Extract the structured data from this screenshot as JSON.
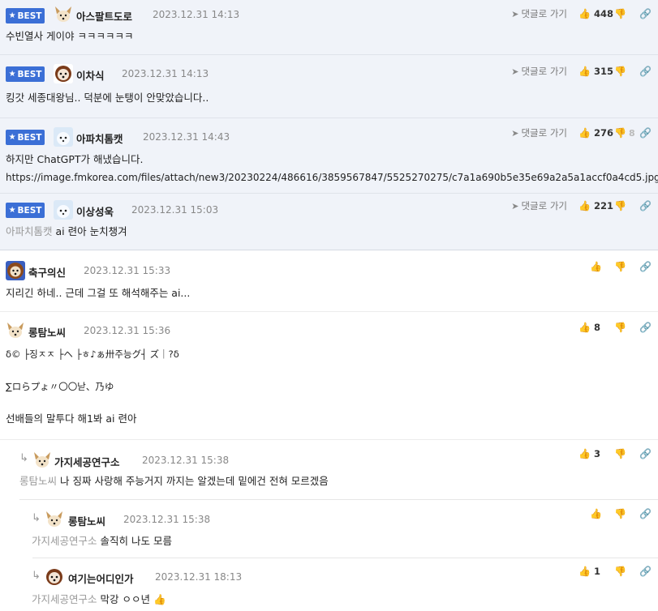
{
  "labels": {
    "best": "BEST",
    "goto_reply": "댓글로 가기"
  },
  "comments": [
    {
      "nick": "아스팔트도로",
      "date": "2023.12.31 14:13",
      "up": "448",
      "down": "",
      "text": "수빈열사 게이야 ㅋㅋㅋㅋㅋㅋ",
      "best": true
    },
    {
      "nick": "이차식",
      "date": "2023.12.31 14:13",
      "up": "315",
      "down": "",
      "text": "킹갓 세종대왕님.. 덕분에 눈탱이 안맞았습니다..",
      "best": true
    },
    {
      "nick": "아파치톰캣",
      "date": "2023.12.31 14:43",
      "up": "276",
      "down": "8",
      "text": "하지만 ChatGPT가 해냈습니다.",
      "text2": "https://image.fmkorea.com/files/attach/new3/20230224/486616/3859567847/5525270275/c7a1a690b5e35e69a2a5a1accf0a4cd5.jpg",
      "best": true
    },
    {
      "nick": "이상성욱",
      "date": "2023.12.31 15:03",
      "up": "221",
      "down": "",
      "mention": "아파치톰캣",
      "text": "ai 련아 눈치챙겨",
      "best": true
    },
    {
      "nick": "축구의신",
      "date": "2023.12.31 15:33",
      "up": "",
      "down": "",
      "text": "지리긴 하네.. 근데 그걸 또 해석해주는 ai..."
    },
    {
      "nick": "롱탐노씨",
      "date": "2023.12.31 15:36",
      "up": "8",
      "down": "",
      "line1": "δ© ├징ㅈㅈ ├ヘ ├ㅎ♪ぁ卅주능グ┤ ズ｜?δ",
      "line2": "∑ロらプょ〃〇〇낟、乃ゆ",
      "line3": "선배들의 말투다 해1봐 ai 련아"
    },
    {
      "nick": "가지세공연구소",
      "date": "2023.12.31 15:38",
      "up": "3",
      "down": "",
      "mention": "롱탐노씨",
      "text": "나 징짜 사랑해 주능거지 까지는 알겠는데 밑에건 전혀 모르겠음"
    },
    {
      "nick": "롱탐노씨",
      "date": "2023.12.31 15:38",
      "up": "",
      "down": "",
      "mention": "가지세공연구소",
      "text": "솔직히 나도 모름"
    },
    {
      "nick": "여기는어디인가",
      "date": "2023.12.31 18:13",
      "up": "1",
      "down": "",
      "mention": "가지세공연구소",
      "text": "막강 ㅇㅇ년 👍"
    }
  ]
}
